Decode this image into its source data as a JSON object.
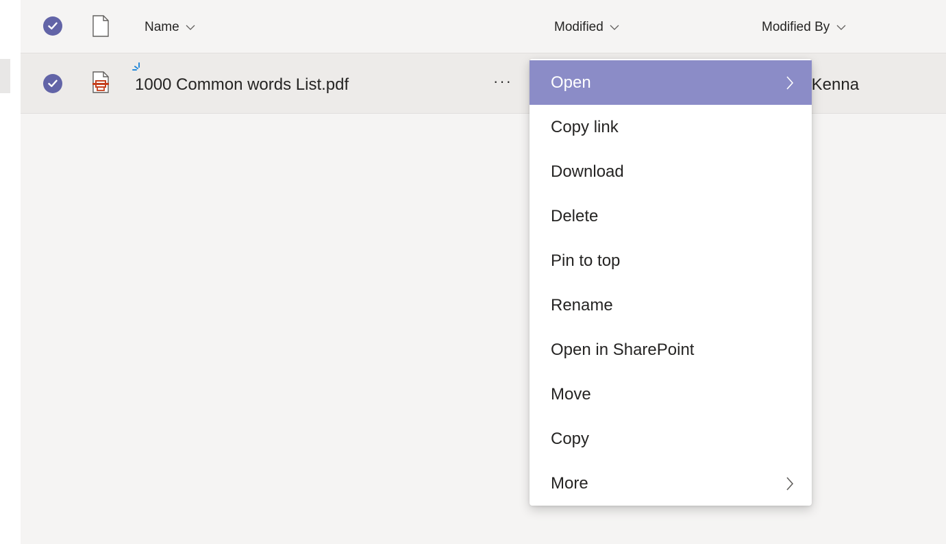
{
  "header": {
    "name_label": "Name",
    "modified_label": "Modified",
    "modified_by_label": "Modified By"
  },
  "file": {
    "name": "1000 Common words List.pdf",
    "modified_by": ":Kenna",
    "more_label": "···"
  },
  "menu": {
    "items": [
      {
        "label": "Open",
        "has_submenu": true,
        "active": true
      },
      {
        "label": "Copy link"
      },
      {
        "label": "Download"
      },
      {
        "label": "Delete"
      },
      {
        "label": "Pin to top"
      },
      {
        "label": "Rename"
      },
      {
        "label": "Open in SharePoint"
      },
      {
        "label": "Move"
      },
      {
        "label": "Copy"
      },
      {
        "label": "More",
        "has_submenu": true
      }
    ]
  },
  "colors": {
    "accent": "#6264a7",
    "menu_hover": "#8b8cc7",
    "pdf_icon": "#c43e1c",
    "new_indicator": "#2488d8"
  }
}
